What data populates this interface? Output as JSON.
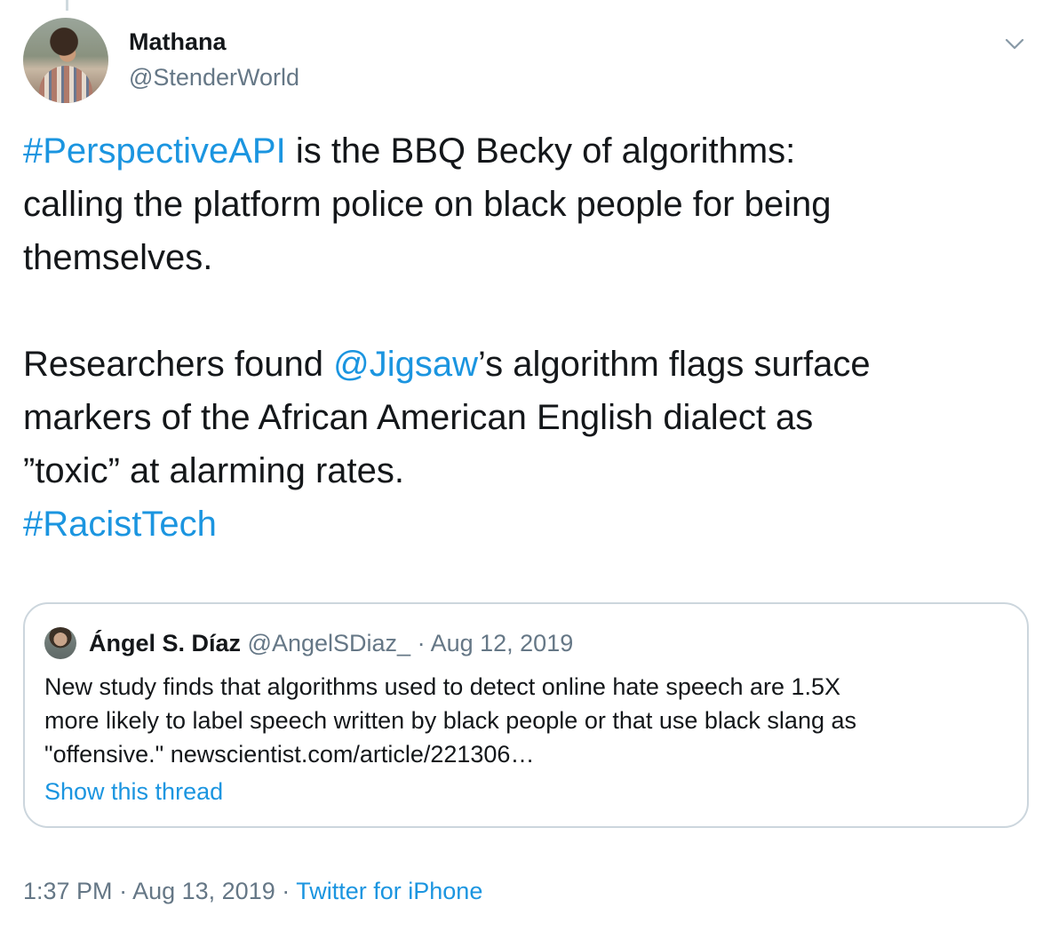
{
  "author": {
    "name": "Mathana",
    "handle": "@StenderWorld"
  },
  "tweet": {
    "line1_hashtag": "#PerspectiveAPI",
    "line1_rest": " is the BBQ Becky of algorithms:",
    "line2": "calling the platform police on black people for being",
    "line3": "themselves.",
    "para2_start": "Researchers found ",
    "para2_mention": "@Jigsaw",
    "para2_rest": "’s algorithm flags surface",
    "line5": "markers of the African American English dialect as",
    "line6": "”toxic” at alarming rates.",
    "hashtag2": "#RacistTech"
  },
  "quoted_tweet": {
    "name": "Ángel S. Díaz",
    "handle": "@AngelSDiaz_",
    "separator": " · ",
    "date": "Aug 12, 2019",
    "body_lines": [
      "New study finds that algorithms used to detect online hate speech are 1.5X",
      "more likely to label speech written by black people or that use black slang as",
      "\"offensive.\" newscientist.com/article/221306…"
    ],
    "show_thread": "Show this thread"
  },
  "meta": {
    "time": "1:37 PM",
    "separator": " · ",
    "date": "Aug 13, 2019",
    "source": "Twitter for iPhone"
  },
  "colors": {
    "link": "#1b95e0",
    "secondary_text": "#657786",
    "border": "#ccd6dd"
  },
  "icons": {
    "caret": "chevron-down-icon"
  }
}
